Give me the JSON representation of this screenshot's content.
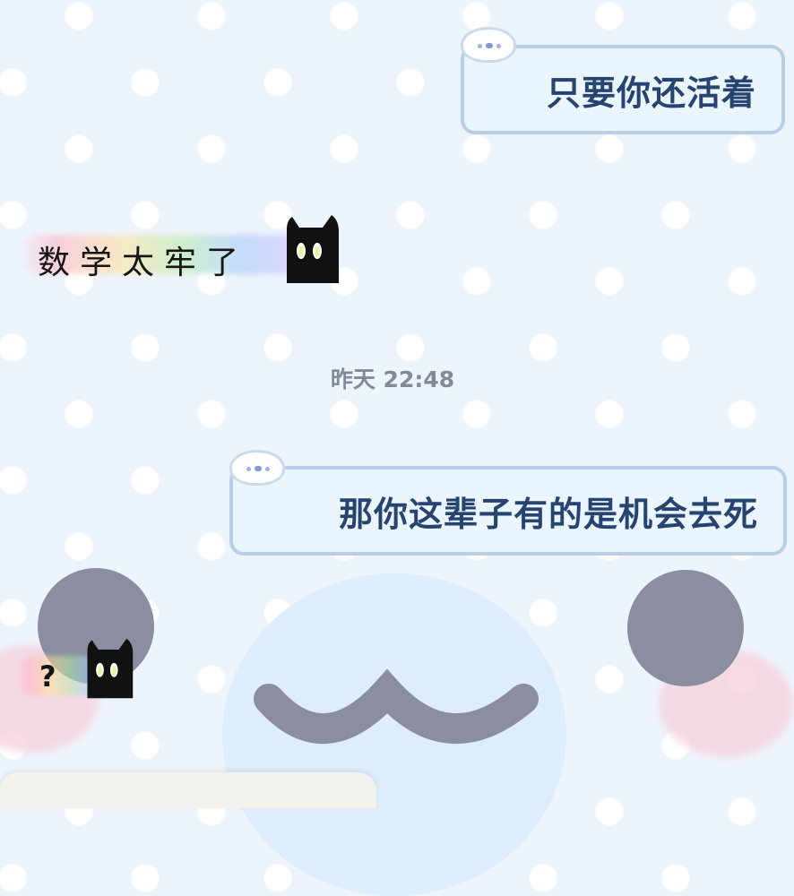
{
  "messages": [
    {
      "direction": "outgoing",
      "text": "只要你还活着"
    },
    {
      "direction": "incoming",
      "text": "数学太牢了"
    },
    {
      "direction": "outgoing",
      "text": "那你这辈子有的是机会去死"
    },
    {
      "direction": "incoming",
      "text": "?"
    }
  ],
  "timestamp": "昨天 22:48",
  "colors": {
    "background": "#eef4fb",
    "bubble_fill": "#ebf5fe",
    "bubble_border": "#b9cfe6",
    "bubble_text": "#27436f",
    "timestamp_text": "#818a96",
    "incoming_text": "#151515"
  },
  "icons": {
    "outgoing_bubble_decoration": "cloud-blob-icon",
    "incoming_avatar": "black-cat-icon"
  }
}
